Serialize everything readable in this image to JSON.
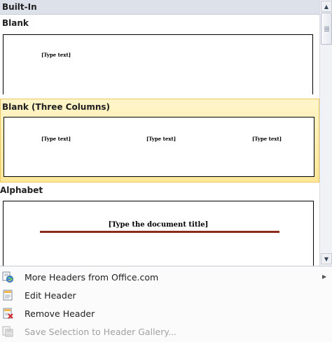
{
  "gallery": {
    "section_title": "Built-In",
    "items": [
      {
        "label": "Blank",
        "placeholders": [
          "[Type text]"
        ]
      },
      {
        "label": "Blank (Three Columns)",
        "placeholders": [
          "[Type text]",
          "[Type text]",
          "[Type text]"
        ],
        "selected": true
      },
      {
        "label": "Alphabet",
        "placeholders": [
          "[Type the document title]"
        ]
      }
    ]
  },
  "colors": {
    "selection_fill": "#ffe79a",
    "selection_border": "#f0c75e",
    "alphabet_rule": "#8c2b1a"
  },
  "menu": {
    "items": [
      {
        "label": "More Headers from Office.com",
        "icon": "office-globe-icon",
        "enabled": true,
        "has_submenu": true
      },
      {
        "label": "Edit Header",
        "icon": "edit-header-icon",
        "enabled": true
      },
      {
        "label": "Remove Header",
        "icon": "remove-header-icon",
        "enabled": true
      },
      {
        "label": "Save Selection to Header Gallery...",
        "icon": "save-gallery-icon",
        "enabled": false
      }
    ]
  }
}
